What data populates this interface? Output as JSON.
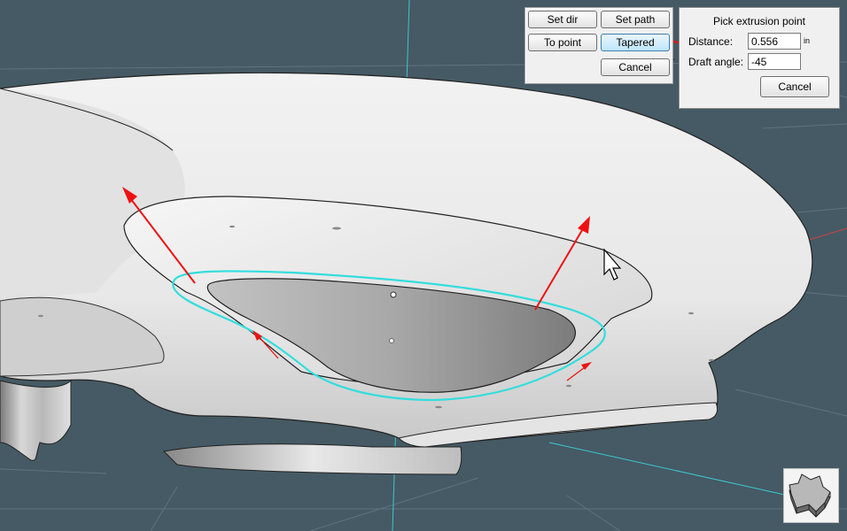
{
  "toolbar": {
    "set_dir": "Set dir",
    "set_path": "Set path",
    "to_point": "To point",
    "tapered": "Tapered",
    "cancel": "Cancel"
  },
  "pick_panel": {
    "title": "Pick extrusion point",
    "distance_label": "Distance:",
    "distance_value": "0.556",
    "distance_unit": "in",
    "draft_label": "Draft angle:",
    "draft_value": "-45",
    "cancel": "Cancel"
  },
  "colors": {
    "background": "#455a64",
    "selection_edge": "#33dddd",
    "arrow": "#ee1111"
  },
  "icons": {
    "cursor": "arrow-cursor-icon",
    "nav": "extrude-shape-icon"
  }
}
